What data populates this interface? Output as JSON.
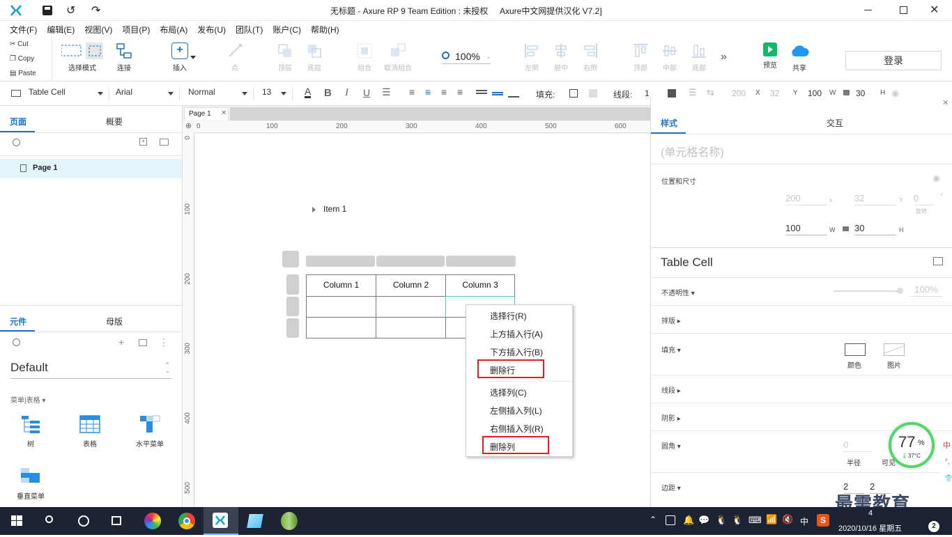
{
  "window": {
    "title": "无标题 - Axure RP 9 Team Edition : 未授权     Axure中文网提供汉化 V7.2]"
  },
  "menu": [
    "文件(F)",
    "编辑(E)",
    "视图(V)",
    "项目(P)",
    "布局(A)",
    "发布(U)",
    "团队(T)",
    "账户(C)",
    "帮助(H)"
  ],
  "clipboard": {
    "cut": "Cut",
    "copy": "Copy",
    "paste": "Paste"
  },
  "toolbar": {
    "select_mode": "选择模式",
    "connect": "连接",
    "insert": "插入",
    "point": "点",
    "top_layer": "顶层",
    "bottom_layer": "底层",
    "group": "组合",
    "ungroup": "取消组合",
    "zoom": "100%",
    "align_left": "左侧",
    "align_center": "居中",
    "align_right": "右侧",
    "align_top": "顶部",
    "align_middle": "中部",
    "align_bottom": "底部",
    "preview": "预览",
    "share": "共享",
    "login": "登录"
  },
  "format": {
    "style": "Table Cell",
    "font": "Arial",
    "weight": "Normal",
    "size": "13",
    "fill_label": "填充:",
    "line_label": "线段:",
    "line_value": "1",
    "x": "200",
    "x_label": "X",
    "y": "32",
    "y_label": "Y",
    "w": "100",
    "w_label": "W",
    "h": "30",
    "h_label": "H"
  },
  "left": {
    "tab_pages": "页面",
    "tab_outline": "概要",
    "page1": "Page 1",
    "tab_widgets": "元件",
    "tab_masters": "母版",
    "library": "Default",
    "category": "菜单|表格 ▾",
    "widgets": [
      "树",
      "表格",
      "水平菜单",
      "垂直菜单"
    ]
  },
  "canvas": {
    "tab": "Page 1",
    "ruler_x": [
      "0",
      "100",
      "200",
      "300",
      "400",
      "500",
      "600"
    ],
    "ruler_y": [
      "0",
      "100",
      "200",
      "300",
      "400",
      "500"
    ],
    "tree_item": "Item 1",
    "columns": [
      "Column 1",
      "Column 2",
      "Column 3"
    ]
  },
  "context_menu": {
    "select_row": "选择行(R)",
    "insert_above": "上方插入行(A)",
    "insert_below": "下方插入行(B)",
    "delete_row": "删除行",
    "select_col": "选择列(C)",
    "insert_left": "左侧插入列(L)",
    "insert_right": "右侧插入列(R)",
    "delete_col": "删除列"
  },
  "right": {
    "tab_style": "样式",
    "tab_interaction": "交互",
    "cell_name_placeholder": "(单元格名称)",
    "pos_size": "位置和尺寸",
    "x": "200",
    "x_label": "x",
    "y": "32",
    "y_label": "Y",
    "rot": "0",
    "rot_unit": "°",
    "rot_label": "旋转",
    "w": "100",
    "w_label": "W",
    "h": "30",
    "h_label": "H",
    "style_name": "Table Cell",
    "opacity_label": "不透明性 ▾",
    "opacity_value": "100%",
    "layout_label": "排版 ▸",
    "fill_label": "填充 ▾",
    "fill_color": "颜色",
    "fill_image": "图片",
    "line_label": "线段 ▸",
    "shadow_label": "阴影 ▸",
    "corner_label": "圆角 ▾",
    "corner_value": "0",
    "corner_radius": "半径",
    "corner_visible": "可见",
    "padding_label": "边距 ▾",
    "padding_a": "2",
    "padding_b": "2"
  },
  "widget_overlay": {
    "percent": "77",
    "unit": "%",
    "temp": "37°C"
  },
  "watermark": "最需教育",
  "taskbar": {
    "ime": "中",
    "time": "4",
    "date": "2020/10/16 星期五",
    "badge": "2"
  },
  "colors": {
    "accent": "#1a73c8",
    "selection": "#5bc0c8",
    "highlight_box": "#e02020",
    "taskbar": "#1c2333",
    "preview_green": "#12b76a",
    "share_blue": "#2196f3",
    "axure_blue": "#0fa1e0"
  }
}
